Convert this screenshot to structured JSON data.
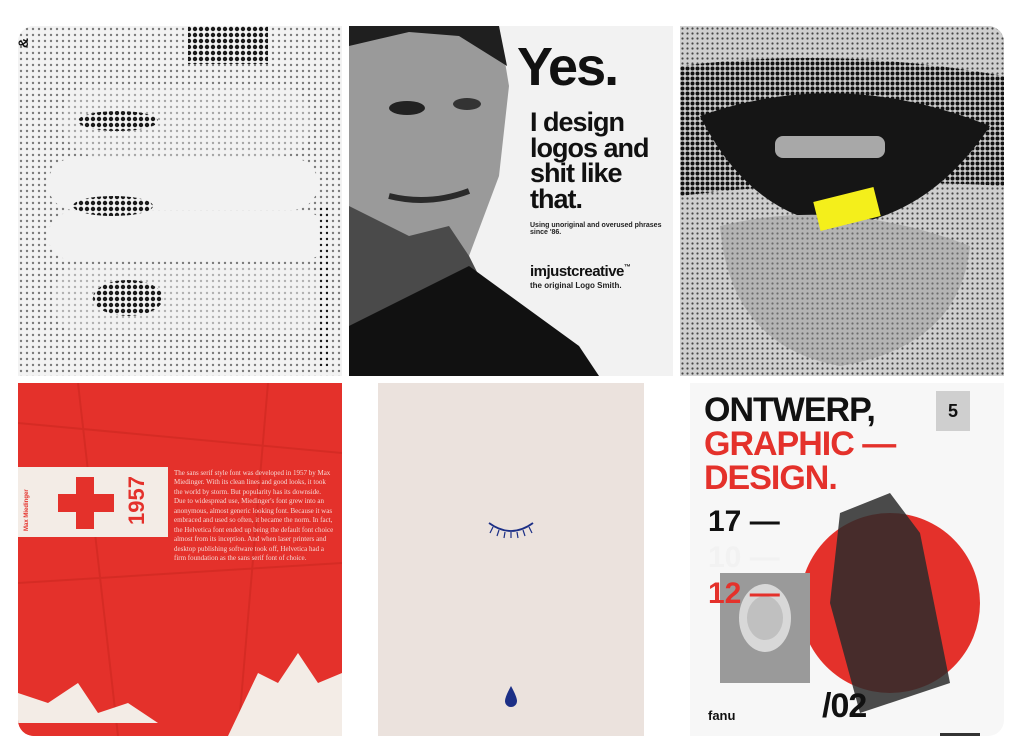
{
  "tiles": {
    "hand": {
      "caption": ""
    },
    "yes": {
      "headline": "Yes.",
      "body": "I design logos and shit like that.",
      "small": "Using unoriginal and overused phrases since '86.",
      "brand": "imjustcreative",
      "brand_tm": "™",
      "brand_sub": "the original Logo Smith."
    },
    "mouth": {
      "tab_color": "#f4ef1b"
    },
    "swiss": {
      "year": "1957",
      "vertical_name": "Max Miedinger",
      "paragraph": "The sans serif style font was developed in 1957 by Max Miedinger. With its clean lines and good looks, it took the world by storm. But popularity has its downside. Due to widespread use, Miedinger's font grew into an anonymous, almost generic looking font. Because it was embraced and used so often, it became the norm. In fact, the Helvetica font ended up being the default font choice almost from its inception. And when laser printers and desktop publishing software took off, Helvetica had a firm foundation as the sans serif font of choice.",
      "accent": "#e4312b"
    },
    "minimal": {
      "drop_color": "#1c2f86"
    },
    "ontwerp": {
      "line1": "ONTWERP,",
      "line2": "GRAPHIC —",
      "line3": "DESIGN.",
      "date1": "17 —",
      "date2": "10 —",
      "date3": "12 —",
      "issue": "/02",
      "badge": "5",
      "logo": "fanu"
    }
  }
}
